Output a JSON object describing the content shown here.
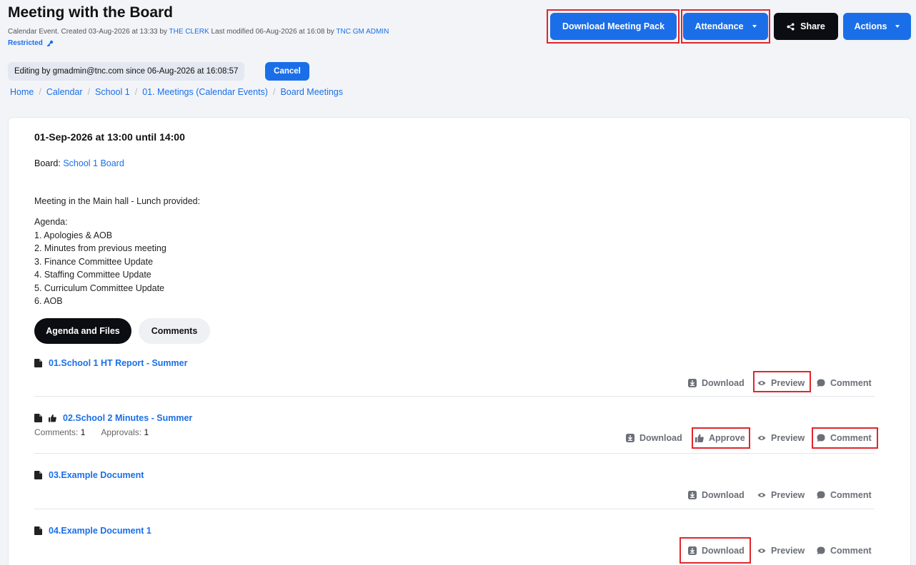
{
  "header": {
    "title": "Meeting with the Board",
    "meta_prefix": "Calendar Event. Created 03-Aug-2026 at 13:33 by",
    "created_by": "THE CLERK",
    "meta_mid": "Last modified 06-Aug-2026 at 16:08 by",
    "modified_by": "TNC GM ADMIN",
    "restricted": "Restricted"
  },
  "editing": {
    "text": "Editing by gmadmin@tnc.com since 06-Aug-2026 at 16:08:57",
    "cancel_label": "Cancel"
  },
  "breadcrumb": [
    "Home",
    "Calendar",
    "School 1",
    "01. Meetings (Calendar Events)",
    "Board Meetings"
  ],
  "toolbar": {
    "download_pack": "Download Meeting Pack",
    "attendance": "Attendance",
    "share": "Share",
    "actions": "Actions"
  },
  "event": {
    "time": "01-Sep-2026 at 13:00 until 14:00",
    "board_label": "Board:",
    "board_name": "School 1 Board",
    "description": "Meeting in the Main hall - Lunch provided:",
    "agenda_heading": "Agenda:",
    "agenda_items": [
      "1. Apologies & AOB",
      "2. Minutes from previous meeting",
      "3. Finance Committee Update",
      "4. Staffing Committee Update",
      "5. Curriculum Committee Update",
      "6. AOB"
    ]
  },
  "tabs": {
    "agenda_files": "Agenda and Files",
    "comments": "Comments"
  },
  "documents": [
    {
      "title": "01.School 1 HT Report - Summer"
    },
    {
      "title": "02.School 2 Minutes - Summer",
      "comments_label": "Comments:",
      "comments_count": "1",
      "approvals_label": "Approvals:",
      "approvals_count": "1"
    },
    {
      "title": "03.Example Document"
    },
    {
      "title": "04.Example Document 1"
    }
  ],
  "doc_actions": {
    "download": "Download",
    "approve": "Approve",
    "preview": "Preview",
    "comment": "Comment"
  },
  "colors": {
    "accent": "#1a6fe8",
    "dark": "#0b0d12",
    "highlight": "#e0262b",
    "action_grey": "#6b6f78"
  }
}
